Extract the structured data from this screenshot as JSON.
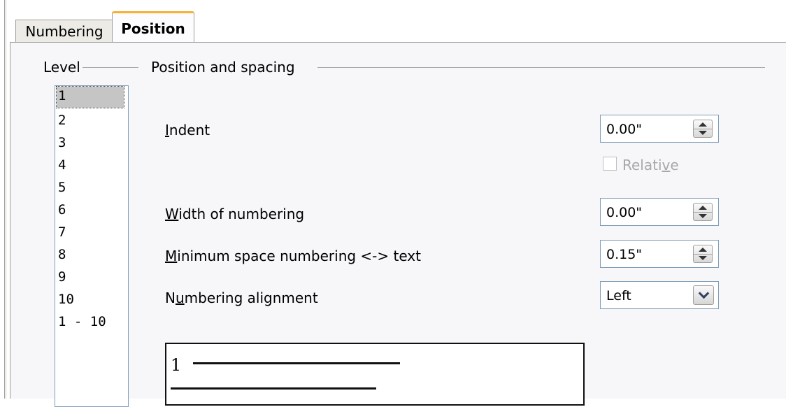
{
  "tabs": [
    {
      "label": "Numbering",
      "active": false
    },
    {
      "label": "Position",
      "active": true
    }
  ],
  "level": {
    "title": "Level",
    "items": [
      "1",
      "2",
      "3",
      "4",
      "5",
      "6",
      "7",
      "8",
      "9",
      "10",
      "1 - 10"
    ],
    "selected": "1"
  },
  "position_spacing": {
    "title": "Position and spacing",
    "indent": {
      "label_mn": "I",
      "label_rest": "ndent",
      "value": "0.00\""
    },
    "relative": {
      "label_pre": "Relati",
      "label_mn": "v",
      "label_post": "e",
      "checked": false,
      "enabled": false
    },
    "width": {
      "label_mn": "W",
      "label_rest": "idth of numbering",
      "value": "0.00\""
    },
    "min_space": {
      "label_mn": "M",
      "label_rest": "inimum space numbering <-> text",
      "value": "0.15\""
    },
    "alignment": {
      "label_pre": "N",
      "label_mn": "u",
      "label_post": "mbering alignment",
      "value": "Left"
    }
  },
  "preview": {
    "number": "1"
  },
  "colors": {
    "active_tab_accent": "#f7b033",
    "selection": "#c5c5c5"
  }
}
